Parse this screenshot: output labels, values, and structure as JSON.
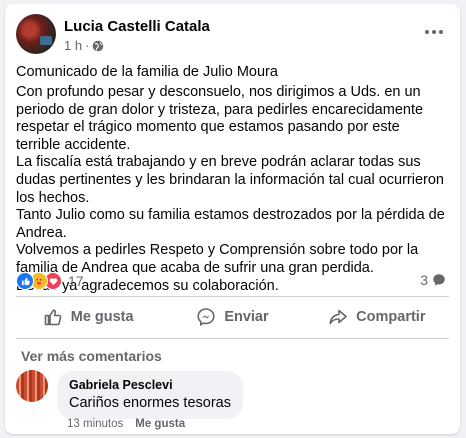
{
  "post": {
    "author": "Lucia Castelli Catala",
    "time": "1 h",
    "title": "Comunicado de la familia de Julio Moura",
    "paragraphs": [
      "Con profundo pesar y desconsuelo, nos dirigimos a Uds. en un periodo de gran dolor y tristeza, para pedirles encarecidamente respetar el trágico momento que estamos pasando por este terrible accidente.",
      "La fiscalía está trabajando y en breve podrán aclarar todas sus dudas pertinentes y les brindaran la información tal cual ocurrieron los hechos.",
      "Tanto Julio como su familia estamos destrozados por la pérdida de Andrea.",
      "Volvemos a pedirles Respeto y Comprensión sobre todo por la familia de Andrea que acaba de sufrir una gran perdida.",
      "Desde ya agradecemos su colaboración."
    ],
    "reactions": [
      "like-icon",
      "care-icon",
      "love-icon"
    ],
    "reaction_count": "17",
    "comment_count": "3"
  },
  "actions": {
    "like": "Me gusta",
    "send": "Enviar",
    "share": "Compartir"
  },
  "comments_section": {
    "see_more": "Ver más comentarios",
    "comment": {
      "author": "Gabriela Pesclevi",
      "text": "Cariños enormes tesoras",
      "time": "13 minutos",
      "like_label": "Me gusta"
    }
  },
  "colors": {
    "background": "#f0f2f5",
    "text_secondary": "#65676b",
    "like": "#1877f2",
    "love": "#f33e58"
  }
}
